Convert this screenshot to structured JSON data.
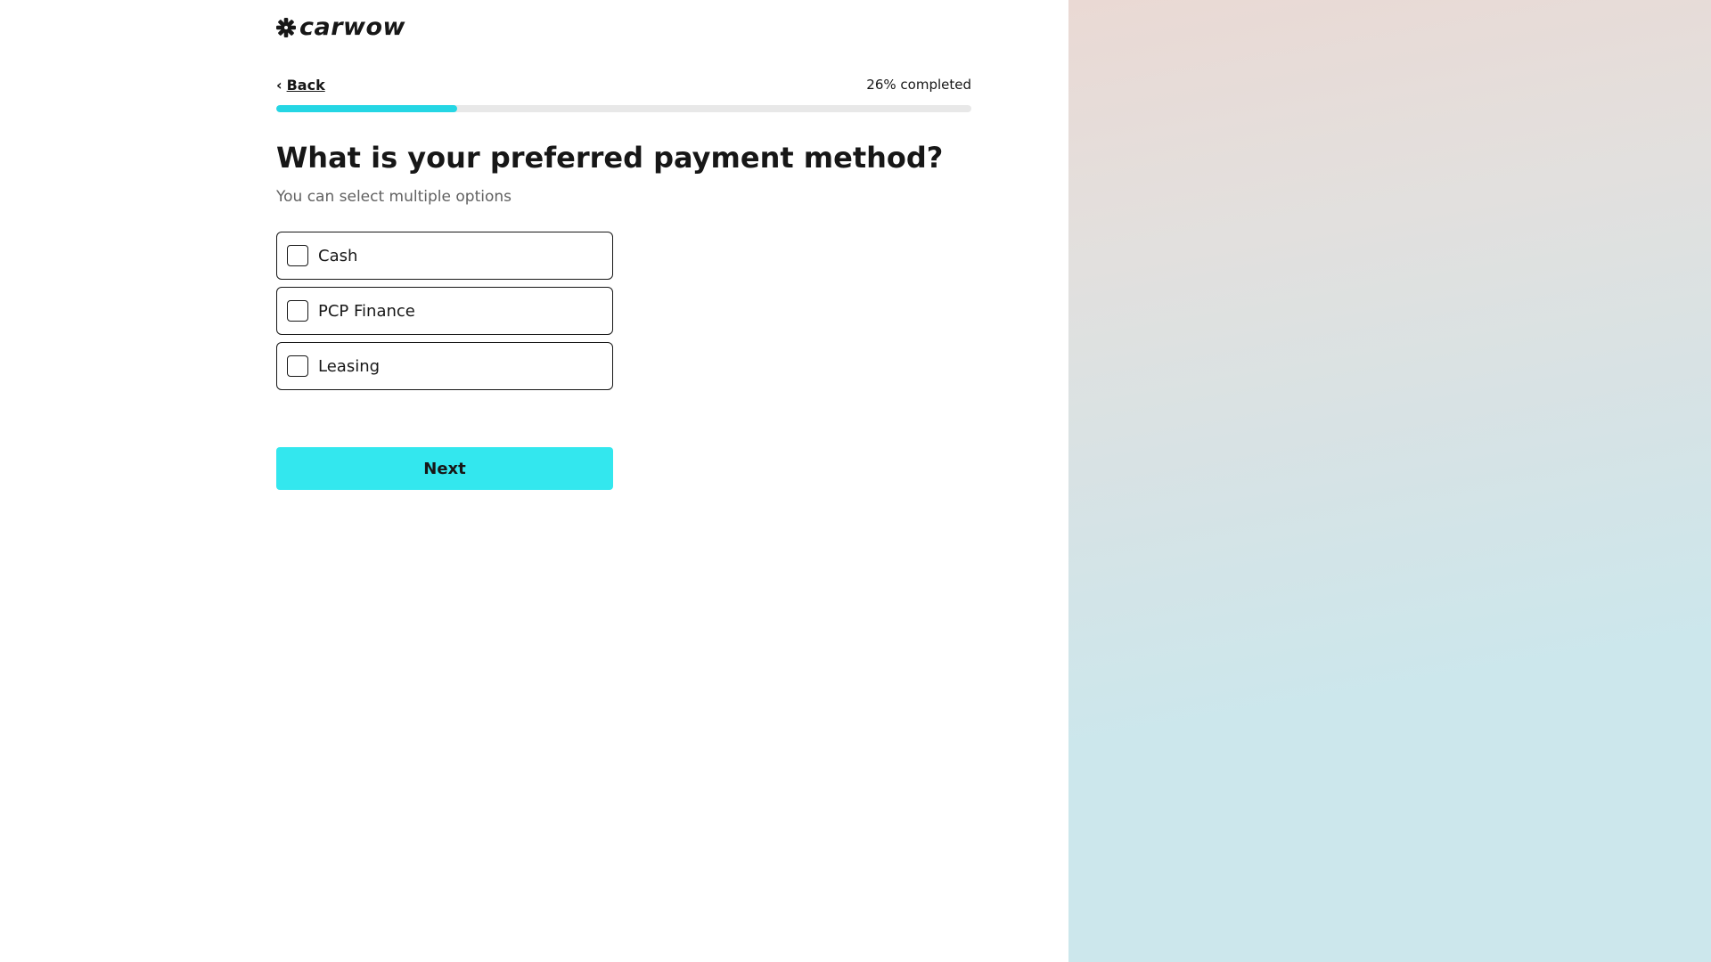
{
  "brand": {
    "logo_text": "carwow",
    "icon": "carwow-asterisk-icon"
  },
  "nav": {
    "back_label": "Back",
    "back_icon": "chevron-left-icon",
    "progress_text": "26% completed",
    "progress_fraction": 0.26
  },
  "question": {
    "title": "What is your preferred payment method?",
    "hint": "You can select multiple options",
    "options": [
      {
        "label": "Cash",
        "checked": false
      },
      {
        "label": "PCP Finance",
        "checked": false
      },
      {
        "label": "Leasing",
        "checked": false
      }
    ]
  },
  "actions": {
    "next_label": "Next"
  },
  "colors": {
    "accent": "#33e7ee",
    "progress_fill": "#25d6e4",
    "progress_track": "#e8e8e8",
    "text": "#171717",
    "muted_text": "#616161"
  }
}
